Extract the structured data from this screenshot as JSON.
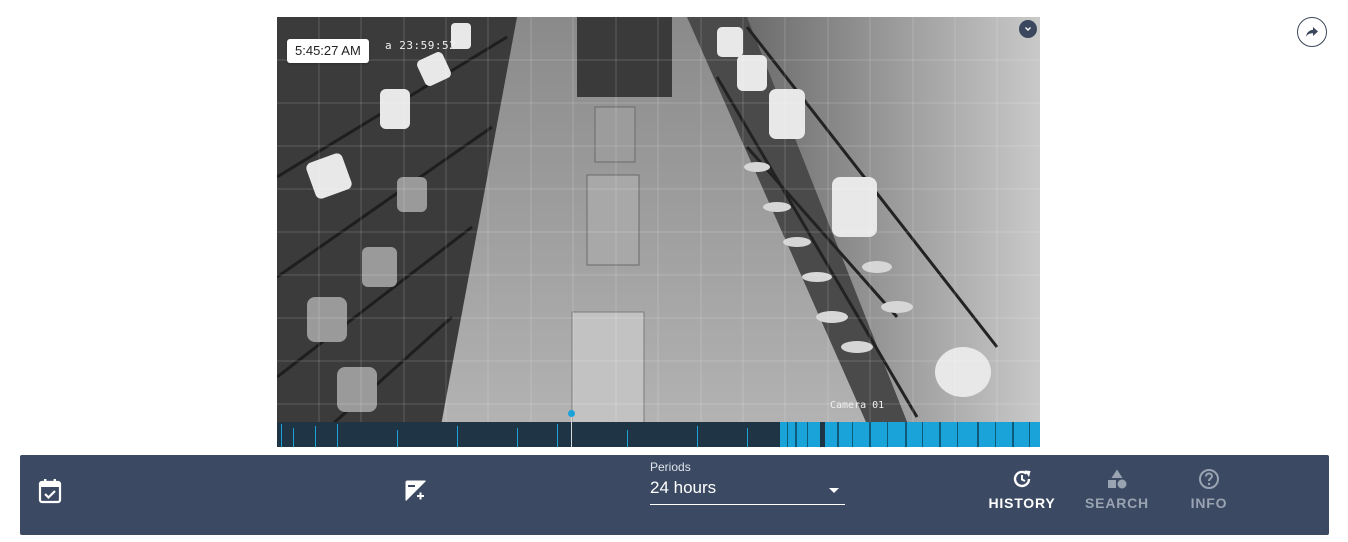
{
  "video": {
    "osd_timestamp": "a 23:59:52",
    "camera_label": "Camera 01",
    "playback_time": "5:45:27 AM",
    "expand_icon": "chevron-down-icon",
    "playhead_position": 0.385
  },
  "share": {
    "icon": "share-arrow-icon"
  },
  "toolbar": {
    "calendar_icon": "calendar-check-icon",
    "exposure_icon": "exposure-icon",
    "periods": {
      "label": "Periods",
      "selected": "24 hours"
    },
    "tabs": [
      {
        "label": "HISTORY",
        "icon": "history-icon",
        "active": true
      },
      {
        "label": "SEARCH",
        "icon": "shapes-icon",
        "active": false
      },
      {
        "label": "INFO",
        "icon": "help-circle-icon",
        "active": false
      }
    ]
  },
  "colors": {
    "toolbar_bg": "#3b4a62",
    "accent": "#1aa3d9",
    "inactive_tab": "#9aa3b2"
  }
}
